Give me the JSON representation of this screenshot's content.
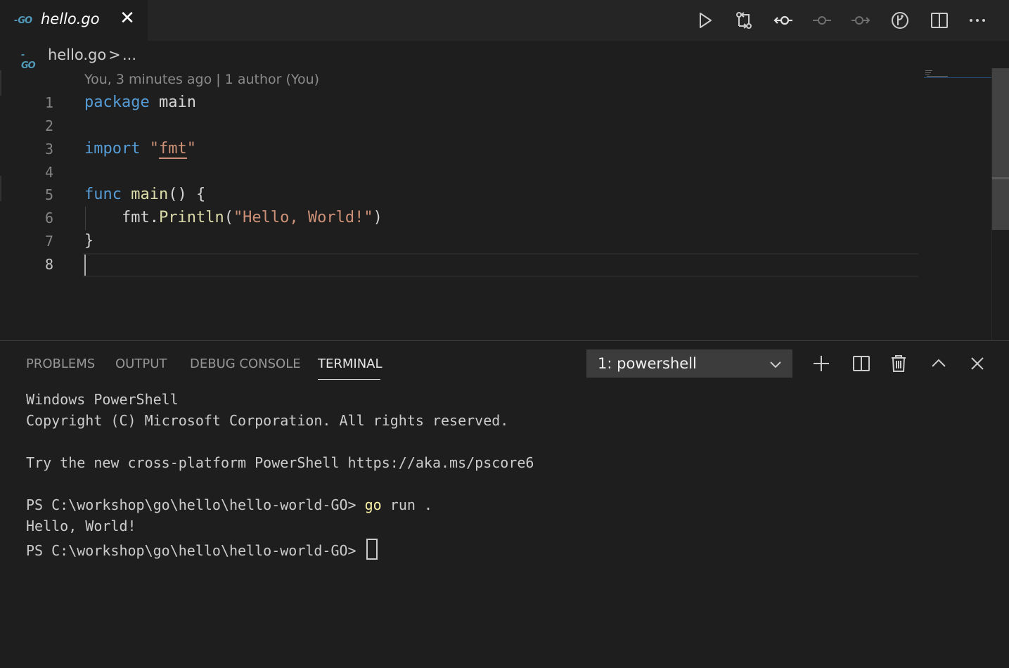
{
  "tab": {
    "title": "hello.go",
    "icon": "go-file-icon",
    "icon_text": "GO"
  },
  "toolbar": {
    "icons": [
      "run-icon",
      "compare-changes-icon",
      "previous-change-icon",
      "timeline-icon",
      "next-change-icon",
      "git-lens-icon",
      "split-editor-icon",
      "more-actions-icon"
    ]
  },
  "breadcrumb": {
    "file": "hello.go",
    "separator": ">",
    "more": "..."
  },
  "editor": {
    "blame": "You, 3 minutes ago | 1 author (You)",
    "active_line": 8,
    "lines": [
      {
        "num": "1"
      },
      {
        "num": "2"
      },
      {
        "num": "3"
      },
      {
        "num": "4"
      },
      {
        "num": "5"
      },
      {
        "num": "6"
      },
      {
        "num": "7"
      },
      {
        "num": "8"
      }
    ],
    "tokens": {
      "l1_kw": "package",
      "l1_rest": " main",
      "l3_kw": "import",
      "l3_q1": " \"",
      "l3_pkg": "fmt",
      "l3_q2": "\"",
      "l5_kw": "func",
      "l5_fn": " main",
      "l5_rest": "() {",
      "l6_pre": "    fmt.",
      "l6_fn": "Println",
      "l6_open": "(",
      "l6_str": "\"Hello, World!\"",
      "l6_close": ")",
      "l7": "}"
    }
  },
  "panel": {
    "tabs": [
      "PROBLEMS",
      "OUTPUT",
      "DEBUG CONSOLE",
      "TERMINAL"
    ],
    "active_tab": "TERMINAL",
    "terminal_select": "1: powershell",
    "actions": [
      "new-terminal-icon",
      "split-terminal-icon",
      "kill-terminal-icon",
      "maximize-panel-icon",
      "close-panel-icon"
    ]
  },
  "terminal": {
    "line1": "Windows PowerShell",
    "line2": "Copyright (C) Microsoft Corporation. All rights reserved.",
    "line3": "Try the new cross-platform PowerShell https://aka.ms/pscore6",
    "prompt": "PS C:\\workshop\\go\\hello\\hello-world-GO> ",
    "command": "go",
    "command_args": " run .",
    "output": "Hello, World!"
  },
  "colors": {
    "background": "#1e1e1e",
    "keyword": "#569cd6",
    "function": "#dcdcaa",
    "string": "#ce9178",
    "terminal_command": "#f9f1a5"
  }
}
